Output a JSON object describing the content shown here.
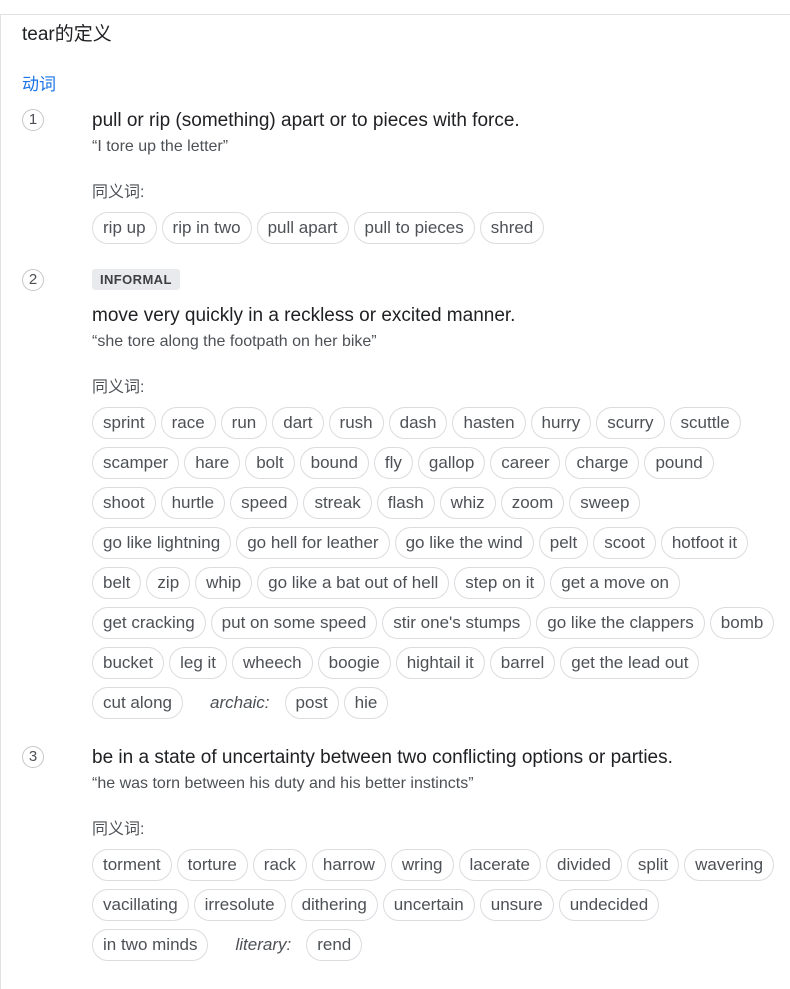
{
  "header": {
    "title": "tear的定义"
  },
  "part_of_speech": "动词",
  "synonyms_label": "同义词:",
  "senses": [
    {
      "number": "1",
      "badge": null,
      "definition": "pull or rip (something) apart or to pieces with force.",
      "example": "“I tore up the letter”",
      "synonyms": [
        {
          "text": "rip up"
        },
        {
          "text": "rip in two"
        },
        {
          "text": "pull apart"
        },
        {
          "text": "pull to pieces"
        },
        {
          "text": "shred"
        }
      ]
    },
    {
      "number": "2",
      "badge": "INFORMAL",
      "definition": "move very quickly in a reckless or excited manner.",
      "example": "“she tore along the footpath on her bike”",
      "synonyms": [
        {
          "text": "sprint"
        },
        {
          "text": "race"
        },
        {
          "text": "run"
        },
        {
          "text": "dart"
        },
        {
          "text": "rush"
        },
        {
          "text": "dash"
        },
        {
          "text": "hasten"
        },
        {
          "text": "hurry"
        },
        {
          "text": "scurry"
        },
        {
          "text": "scuttle"
        },
        {
          "text": "scamper"
        },
        {
          "text": "hare"
        },
        {
          "text": "bolt"
        },
        {
          "text": "bound"
        },
        {
          "text": "fly"
        },
        {
          "text": "gallop"
        },
        {
          "text": "career"
        },
        {
          "text": "charge"
        },
        {
          "text": "pound"
        },
        {
          "text": "shoot"
        },
        {
          "text": "hurtle"
        },
        {
          "text": "speed"
        },
        {
          "text": "streak"
        },
        {
          "text": "flash"
        },
        {
          "text": "whiz"
        },
        {
          "text": "zoom"
        },
        {
          "text": "sweep"
        },
        {
          "text": "go like lightning"
        },
        {
          "text": "go hell for leather"
        },
        {
          "text": "go like the wind"
        },
        {
          "text": "pelt"
        },
        {
          "text": "scoot"
        },
        {
          "text": "hotfoot it"
        },
        {
          "text": "belt"
        },
        {
          "text": "zip"
        },
        {
          "text": "whip"
        },
        {
          "text": "go like a bat out of hell"
        },
        {
          "text": "step on it"
        },
        {
          "text": "get a move on"
        },
        {
          "text": "get cracking"
        },
        {
          "text": "put on some speed"
        },
        {
          "text": "stir one's stumps"
        },
        {
          "text": "go like the clappers"
        },
        {
          "text": "bomb"
        },
        {
          "text": "bucket"
        },
        {
          "text": "leg it"
        },
        {
          "text": "wheech"
        },
        {
          "text": "boogie"
        },
        {
          "text": "hightail it"
        },
        {
          "text": "barrel"
        },
        {
          "text": "get the lead out"
        },
        {
          "text": "cut along"
        },
        {
          "register": "archaic:"
        },
        {
          "text": "post"
        },
        {
          "text": "hie"
        }
      ]
    },
    {
      "number": "3",
      "badge": null,
      "definition": "be in a state of uncertainty between two conflicting options or parties.",
      "example": "“he was torn between his duty and his better instincts”",
      "synonyms": [
        {
          "text": "torment"
        },
        {
          "text": "torture"
        },
        {
          "text": "rack"
        },
        {
          "text": "harrow"
        },
        {
          "text": "wring"
        },
        {
          "text": "lacerate"
        },
        {
          "text": "divided"
        },
        {
          "text": "split"
        },
        {
          "text": "wavering"
        },
        {
          "text": "vacillating"
        },
        {
          "text": "irresolute"
        },
        {
          "text": "dithering"
        },
        {
          "text": "uncertain"
        },
        {
          "text": "unsure"
        },
        {
          "text": "undecided"
        },
        {
          "text": "in two minds"
        },
        {
          "register": "literary:"
        },
        {
          "text": "rend"
        }
      ]
    }
  ]
}
